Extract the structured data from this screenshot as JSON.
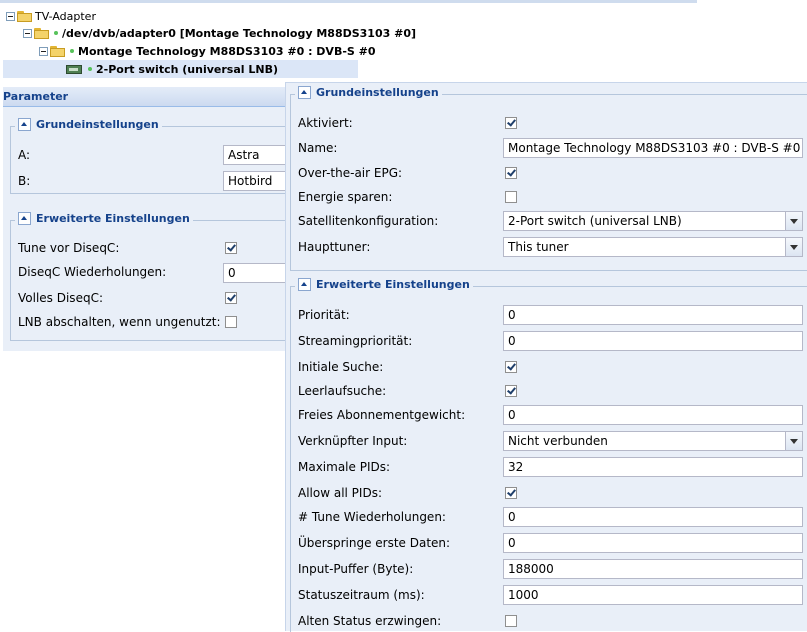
{
  "tree": {
    "root": "TV-Adapter",
    "adapter": "/dev/dvb/adapter0 [Montage Technology M88DS3103 #0]",
    "frontend": "Montage Technology M88DS3103 #0 : DVB-S #0",
    "network": "2-Port switch (universal LNB)"
  },
  "left_panel": {
    "title": "Parameter",
    "basic": {
      "legend": "Grundeinstellungen",
      "a_label": "A:",
      "a_value": "Astra",
      "b_label": "B:",
      "b_value": "Hotbird"
    },
    "advanced": {
      "legend": "Erweiterte Einstellungen",
      "tune_before_label": "Tune vor DiseqC:",
      "tune_before_checked": true,
      "diseqc_repeats_label": "DiseqC Wiederholungen:",
      "diseqc_repeats_value": "0",
      "full_diseqc_label": "Volles DiseqC:",
      "full_diseqc_checked": true,
      "lnb_off_label": "LNB abschalten, wenn ungenutzt:",
      "lnb_off_checked": false
    }
  },
  "right_panel": {
    "basic": {
      "legend": "Grundeinstellungen",
      "enabled_label": "Aktiviert:",
      "enabled_checked": true,
      "name_label": "Name:",
      "name_value": "Montage Technology M88DS3103 #0 : DVB-S #0",
      "ota_epg_label": "Over-the-air EPG:",
      "ota_epg_checked": true,
      "power_save_label": "Energie sparen:",
      "power_save_checked": false,
      "satconf_label": "Satellitenkonfiguration:",
      "satconf_value": "2-Port switch (universal LNB)",
      "master_label": "Haupttuner:",
      "master_value": "This tuner"
    },
    "advanced": {
      "legend": "Erweiterte Einstellungen",
      "priority_label": "Priorität:",
      "priority_value": "0",
      "streaming_priority_label": "Streamingpriorität:",
      "streaming_priority_value": "0",
      "initial_scan_label": "Initiale Suche:",
      "initial_scan_checked": true,
      "idle_scan_label": "Leerlaufsuche:",
      "idle_scan_checked": true,
      "free_weight_label": "Freies Abonnementgewicht:",
      "free_weight_value": "0",
      "linked_input_label": "Verknüpfter Input:",
      "linked_input_value": "Nicht verbunden",
      "max_pids_label": "Maximale PIDs:",
      "max_pids_value": "32",
      "allow_all_pids_label": "Allow all PIDs:",
      "allow_all_pids_checked": true,
      "tune_repeats_label": "# Tune Wiederholungen:",
      "tune_repeats_value": "0",
      "skip_initial_label": "Überspringe erste Daten:",
      "skip_initial_value": "0",
      "input_buffer_label": "Input-Puffer (Byte):",
      "input_buffer_value": "188000",
      "status_period_label": "Statuszeitraum (ms):",
      "status_period_value": "1000",
      "force_old_status_label": "Alten Status erzwingen:",
      "force_old_status_checked": false
    }
  }
}
